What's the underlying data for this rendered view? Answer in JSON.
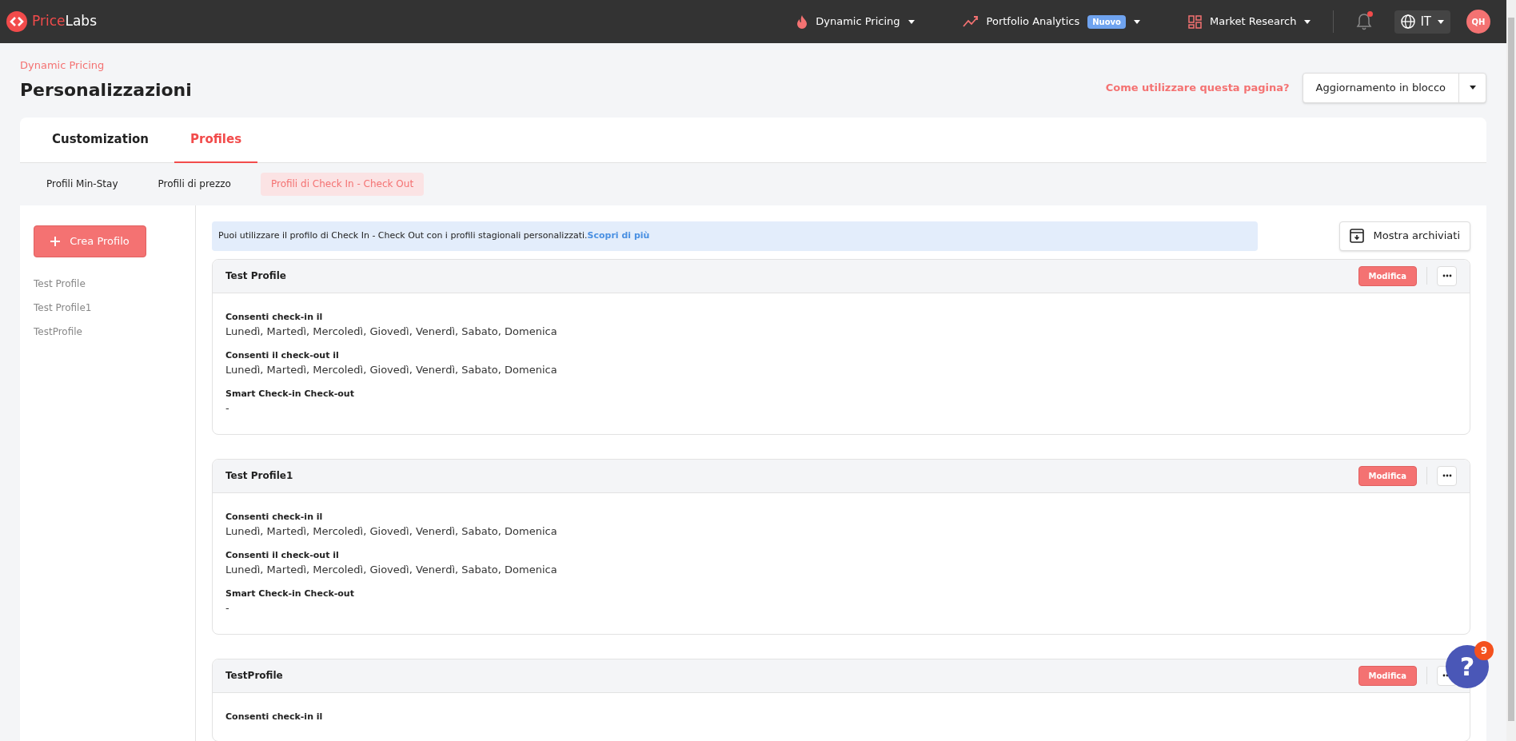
{
  "topbar": {
    "logo": {
      "part_1": "Price",
      "part_2": "Labs"
    },
    "nav": [
      {
        "label": "Dynamic Pricing"
      },
      {
        "label": "Portfolio Analytics",
        "badge": "Nuovo"
      },
      {
        "label": "Market Research"
      }
    ],
    "notifications": {
      "unread": true
    },
    "language": "IT",
    "avatar": "QH"
  },
  "breadcrumb": "Dynamic Pricing",
  "title": "Personalizzazioni",
  "help_link": "Come utilizzare questa pagina?",
  "bulk_button": "Aggiornamento in blocco",
  "tabs": [
    {
      "label": "Customization",
      "selected": false
    },
    {
      "label": "Profiles",
      "selected": true
    }
  ],
  "subtabs": [
    {
      "label": "Profili Min-Stay",
      "selected": false
    },
    {
      "label": "Profili di prezzo",
      "selected": false
    },
    {
      "label": "Profili di Check In - Check Out",
      "selected": true
    }
  ],
  "sidebar": {
    "create_button": "Crea Profilo",
    "items": [
      "Test Profile",
      "Test Profile1",
      "TestProfile"
    ]
  },
  "notice": {
    "text": "Puoi utilizzare il profilo di Check In - Check Out con i profili stagionali personalizzati.",
    "link": "Scopri di più"
  },
  "archive_button": "Mostra archiviati",
  "profiles": [
    {
      "name": "Test Profile",
      "edit": "Modifica",
      "fields": [
        {
          "label": "Consenti check-in il",
          "value": "Lunedì, Martedì, Mercoledì, Giovedì, Venerdì, Sabato, Domenica"
        },
        {
          "label": "Consenti il check-out il",
          "value": "Lunedì, Martedì, Mercoledì, Giovedì, Venerdì, Sabato, Domenica"
        },
        {
          "label": "Smart Check-in Check-out",
          "value": "-"
        }
      ]
    },
    {
      "name": "Test Profile1",
      "edit": "Modifica",
      "fields": [
        {
          "label": "Consenti check-in il",
          "value": "Lunedì, Martedì, Mercoledì, Giovedì, Venerdì, Sabato, Domenica"
        },
        {
          "label": "Consenti il check-out il",
          "value": "Lunedì, Martedì, Mercoledì, Giovedì, Venerdì, Sabato, Domenica"
        },
        {
          "label": "Smart Check-in Check-out",
          "value": "-"
        }
      ]
    },
    {
      "name": "TestProfile",
      "edit": "Modifica",
      "fields": [
        {
          "label": "Consenti check-in il"
        }
      ]
    }
  ],
  "help_widget": {
    "symbol": "?",
    "badge": "9"
  }
}
